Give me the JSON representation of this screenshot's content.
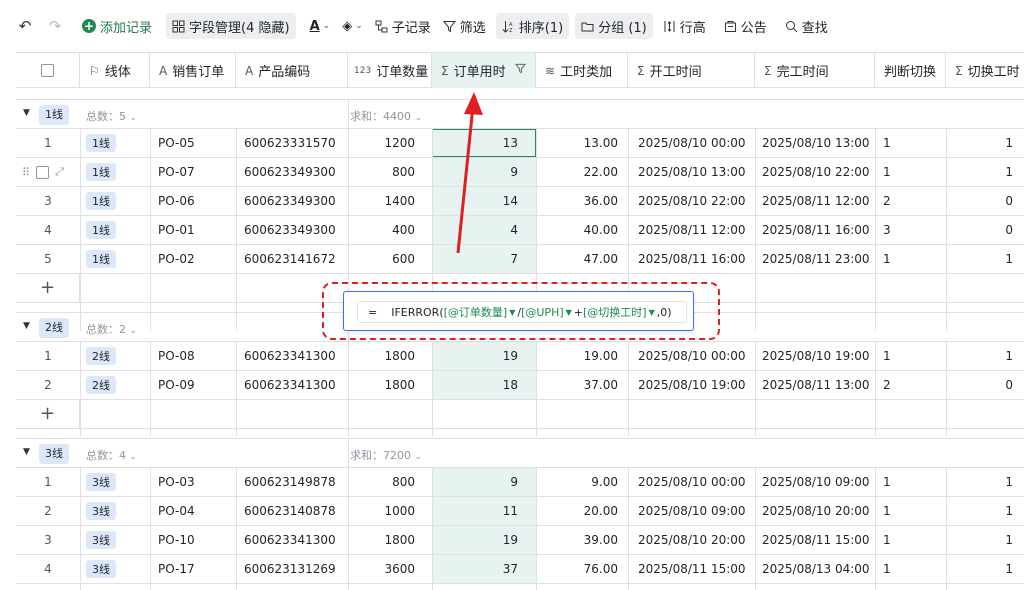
{
  "toolbar": {
    "undo": "↶",
    "redo": "↷",
    "add_record": "添加记录",
    "field_manage": "字段管理(4 隐藏)",
    "text_format": "A",
    "fill_color": "◈",
    "sub_record": "子记录",
    "filter": "筛选",
    "sort": "排序(1)",
    "group": "分组 (1)",
    "row_height": "行高",
    "notice": "公告",
    "search": "查找"
  },
  "columns": [
    {
      "icon": "⚐",
      "label": "线体"
    },
    {
      "icon": "A",
      "label": "销售订单"
    },
    {
      "icon": "A",
      "label": "产品编码"
    },
    {
      "icon": "123",
      "label": "订单数量"
    },
    {
      "icon": "Σ",
      "label": "订单用时"
    },
    {
      "icon": "≋",
      "label": "工时类加"
    },
    {
      "icon": "Σ",
      "label": "开工时间"
    },
    {
      "icon": "Σ",
      "label": "完工时间"
    },
    {
      "icon": "",
      "label": "判断切换"
    },
    {
      "icon": "Σ",
      "label": "切换工时"
    }
  ],
  "groups": [
    {
      "tag": "1线",
      "count": "总数：5",
      "sum": "求和：4400",
      "rows": [
        {
          "idx": "1",
          "line": "1线",
          "po": "PO-05",
          "code": "600623331570",
          "qty": "1200",
          "time": "13",
          "add": "13.00",
          "start": "2025/08/10 00:00",
          "end": "2025/08/10 13:00",
          "judge": "1",
          "sw": "1"
        },
        {
          "idx": "2",
          "line": "1线",
          "po": "PO-07",
          "code": "600623349300",
          "qty": "800",
          "time": "9",
          "add": "22.00",
          "start": "2025/08/10 13:00",
          "end": "2025/08/10 22:00",
          "judge": "1",
          "sw": "1"
        },
        {
          "idx": "3",
          "line": "1线",
          "po": "PO-06",
          "code": "600623349300",
          "qty": "1400",
          "time": "14",
          "add": "36.00",
          "start": "2025/08/10 22:00",
          "end": "2025/08/11 12:00",
          "judge": "2",
          "sw": "0"
        },
        {
          "idx": "4",
          "line": "1线",
          "po": "PO-01",
          "code": "600623349300",
          "qty": "400",
          "time": "4",
          "add": "40.00",
          "start": "2025/08/11 12:00",
          "end": "2025/08/11 16:00",
          "judge": "3",
          "sw": "0"
        },
        {
          "idx": "5",
          "line": "1线",
          "po": "PO-02",
          "code": "600623141672",
          "qty": "600",
          "time": "7",
          "add": "47.00",
          "start": "2025/08/11 16:00",
          "end": "2025/08/11 23:00",
          "judge": "1",
          "sw": "1"
        }
      ]
    },
    {
      "tag": "2线",
      "count": "总数：2",
      "sum": "",
      "rows": [
        {
          "idx": "1",
          "line": "2线",
          "po": "PO-08",
          "code": "600623341300",
          "qty": "1800",
          "time": "19",
          "add": "19.00",
          "start": "2025/08/10 00:00",
          "end": "2025/08/10 19:00",
          "judge": "1",
          "sw": "1"
        },
        {
          "idx": "2",
          "line": "2线",
          "po": "PO-09",
          "code": "600623341300",
          "qty": "1800",
          "time": "18",
          "add": "37.00",
          "start": "2025/08/10 19:00",
          "end": "2025/08/11 13:00",
          "judge": "2",
          "sw": "0"
        }
      ]
    },
    {
      "tag": "3线",
      "count": "总数：4",
      "sum": "求和：7200",
      "rows": [
        {
          "idx": "1",
          "line": "3线",
          "po": "PO-03",
          "code": "600623149878",
          "qty": "800",
          "time": "9",
          "add": "9.00",
          "start": "2025/08/10 00:00",
          "end": "2025/08/10 09:00",
          "judge": "1",
          "sw": "1"
        },
        {
          "idx": "2",
          "line": "3线",
          "po": "PO-04",
          "code": "600623140878",
          "qty": "1000",
          "time": "11",
          "add": "20.00",
          "start": "2025/08/10 09:00",
          "end": "2025/08/10 20:00",
          "judge": "1",
          "sw": "1"
        },
        {
          "idx": "3",
          "line": "3线",
          "po": "PO-10",
          "code": "600623341300",
          "qty": "1800",
          "time": "19",
          "add": "39.00",
          "start": "2025/08/10 20:00",
          "end": "2025/08/11 15:00",
          "judge": "1",
          "sw": "1"
        },
        {
          "idx": "4",
          "line": "3线",
          "po": "PO-17",
          "code": "600623131269",
          "qty": "3600",
          "time": "37",
          "add": "76.00",
          "start": "2025/08/11 15:00",
          "end": "2025/08/13 04:00",
          "judge": "1",
          "sw": "1"
        }
      ]
    }
  ],
  "formula": {
    "eq": "=",
    "fn_open": "IFERROR(",
    "ref1": "[@订单数量]",
    "op1": "/",
    "ref2": "[@UPH]",
    "op2": "+",
    "ref3": "[@切换工时]",
    "tail": ",0)"
  },
  "colors": {
    "accent": "#1f8a4f",
    "selected_column": "#e6f3f0",
    "annotation": "#e02020",
    "tag_bg": "#dce8f8"
  }
}
